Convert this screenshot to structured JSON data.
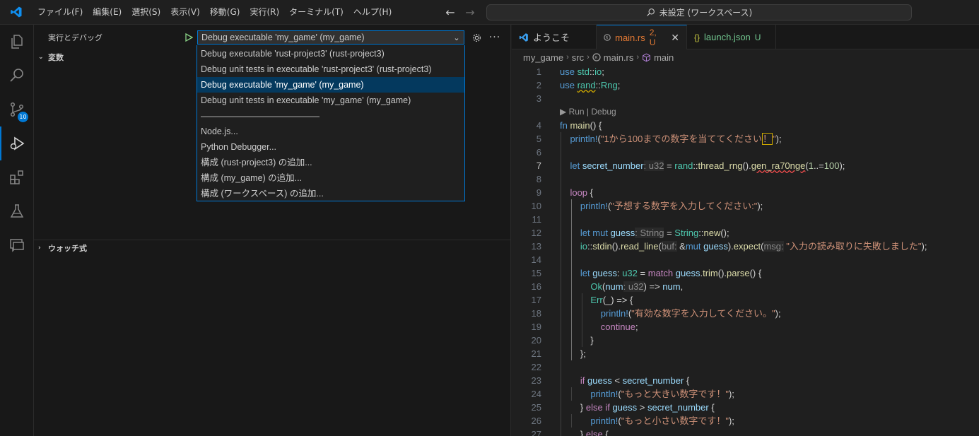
{
  "menu": [
    "ファイル(F)",
    "編集(E)",
    "選択(S)",
    "表示(V)",
    "移動(G)",
    "実行(R)",
    "ターミナル(T)",
    "ヘルプ(H)"
  ],
  "command_center": {
    "label": "未設定 (ワークスペース)"
  },
  "activity": {
    "scm_badge": "10"
  },
  "sidebar": {
    "title": "実行とデバッグ",
    "selected_config": "Debug executable 'my_game' (my_game)",
    "variables_header": "変数",
    "watch_header": "ウォッチ式"
  },
  "dropdown": {
    "items": [
      "Debug executable 'rust-project3' (rust-project3)",
      "Debug unit tests in executable 'rust-project3' (rust-project3)",
      "Debug executable 'my_game' (my_game)",
      "Debug unit tests in executable 'my_game' (my_game)",
      "——————————————",
      "Node.js...",
      "Python Debugger...",
      "構成 (rust-project3) の追加...",
      "構成 (my_game) の追加...",
      "構成 (ワークスペース) の追加..."
    ],
    "selected_index": 2
  },
  "tabs": [
    {
      "label": "ようこそ",
      "modified": ""
    },
    {
      "label": "main.rs",
      "modified": "2, U"
    },
    {
      "label": "launch.json",
      "modified": "U"
    }
  ],
  "breadcrumbs": [
    "my_game",
    "src",
    "main.rs",
    "main"
  ],
  "editor": {
    "codelens": "▶ Run | Debug",
    "current_line": 7
  },
  "colors": {
    "accent": "#0078d4",
    "modified_tab": "#e37933",
    "untracked": "#73c991"
  }
}
